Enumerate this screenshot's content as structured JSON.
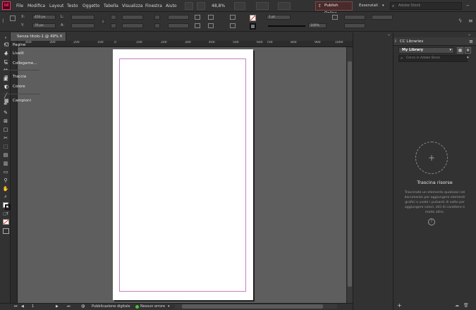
{
  "app": {
    "logo": "Id"
  },
  "menu": [
    "File",
    "Modifica",
    "Layout",
    "Testo",
    "Oggetto",
    "Tabella",
    "Visualizza",
    "Finestra",
    "Aiuto"
  ],
  "toolbar_top": {
    "zoom": "48,8%",
    "publish_label": "Publish Online",
    "workspace": "Essenziali",
    "search_placeholder": "Adobe Stock"
  },
  "control": {
    "x_label": "X:",
    "x_value": "450 px",
    "y_label": "Y:",
    "y_value": "76 px",
    "w_label": "L:",
    "h_label": "A:",
    "stroke_weight": "1 pt",
    "opacity": "100%"
  },
  "document": {
    "tab_label": "Senza titolo-1 @ 49%"
  },
  "ruler": {
    "h_ticks": [
      "400",
      "300",
      "200",
      "100",
      "0",
      "100",
      "200",
      "300",
      "400",
      "500",
      "600",
      "700",
      "800",
      "900",
      "1000"
    ]
  },
  "status": {
    "page": "1",
    "preflight_profile": "Pubblicazione digitale",
    "errors": "Nessun errore"
  },
  "dock": {
    "items": [
      {
        "label": "Pagine",
        "icon": "pages-icon"
      },
      {
        "label": "Livelli",
        "icon": "layers-icon"
      },
      {
        "label": "Collegame...",
        "icon": "links-icon"
      },
      {
        "label": "Traccia",
        "icon": "stroke-icon"
      },
      {
        "label": "Colore",
        "icon": "color-icon"
      },
      {
        "label": "Campioni",
        "icon": "swatches-icon"
      }
    ]
  },
  "libraries": {
    "panel_title": "CC Libraries",
    "library_select": "My Library",
    "search_placeholder": "Cerca in Adobe Stock",
    "empty_title": "Trascina risorse",
    "empty_desc": "Trascinate un elemento qualsiasi nel documento per aggiungere elementi grafici o usate i pulsanti di sotto per aggiungere colori, stili di carattere e molto altro."
  },
  "colors": {
    "accent": "#ff3366",
    "margin_guide": "#c57ec5",
    "page": "#ffffff",
    "pasteboard": "#5e5e5e"
  }
}
